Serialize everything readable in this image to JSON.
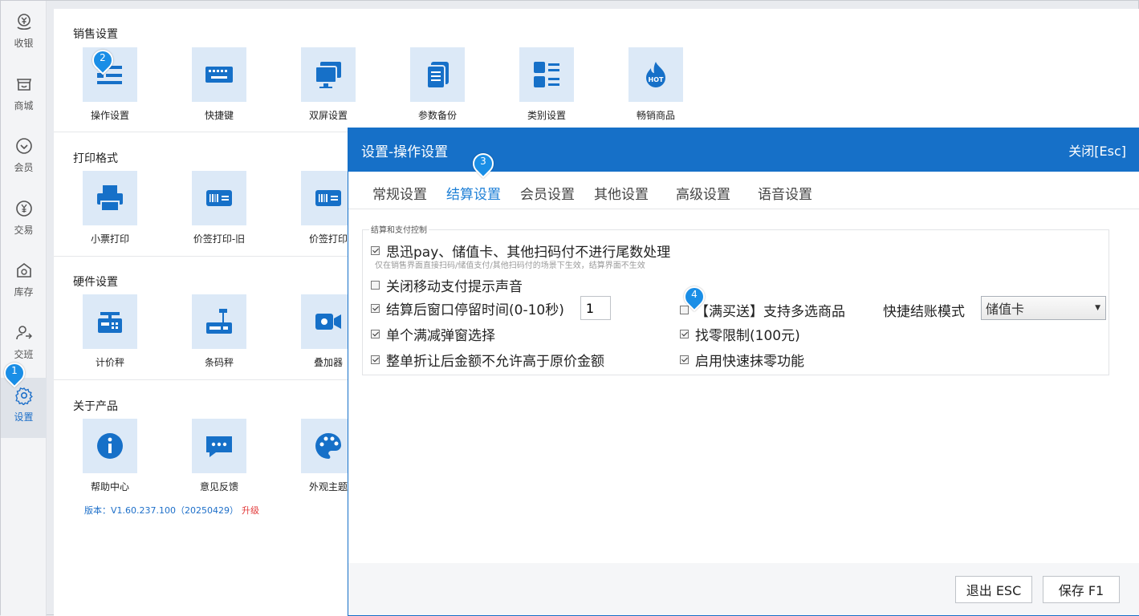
{
  "nav": {
    "items": [
      {
        "label": "收银",
        "icon": "cashier-icon"
      },
      {
        "label": "商城",
        "icon": "store-icon"
      },
      {
        "label": "会员",
        "icon": "member-icon"
      },
      {
        "label": "交易",
        "icon": "transaction-icon"
      },
      {
        "label": "库存",
        "icon": "inventory-icon"
      },
      {
        "label": "交班",
        "icon": "shift-icon"
      },
      {
        "label": "设置",
        "icon": "settings-gear-icon"
      }
    ]
  },
  "main": {
    "sections": [
      {
        "title": "销售设置",
        "tiles": [
          "操作设置",
          "快捷键",
          "双屏设置",
          "参数备份",
          "类别设置",
          "畅销商品"
        ]
      },
      {
        "title": "打印格式",
        "tiles": [
          "小票打印",
          "价签打印-旧",
          "价签打印"
        ]
      },
      {
        "title": "硬件设置",
        "tiles": [
          "计价秤",
          "条码秤",
          "叠加器"
        ]
      },
      {
        "title": "关于产品",
        "tiles": [
          "帮助中心",
          "意见反馈",
          "外观主题"
        ]
      }
    ],
    "version": "版本：V1.60.237.100（20250429）",
    "upgrade": "升级"
  },
  "markers": [
    "1",
    "2",
    "3",
    "4"
  ],
  "dialog": {
    "title": "设置-操作设置",
    "close": "关闭[Esc]",
    "tabs": [
      "常规设置",
      "结算设置",
      "会员设置",
      "其他设置",
      "高级设置",
      "语音设置"
    ],
    "active_tab": "结算设置",
    "group_title": "结算和支付控制",
    "options": {
      "rounding": "思迅pay、储值卡、其他扫码付不进行尾数处理",
      "rounding_hint": "仅在销售界面直接扫码/储值支付/其他扫码付的场景下生效，结算界面不生效",
      "mute": "关闭移动支付提示声音",
      "stay_time": "结算后窗口停留时间(0-10秒)",
      "stay_value": "1",
      "discount_popup": "单个满减弹窗选择",
      "no_exceed": "整单折让后金额不允许高于原价金额",
      "buy_gift": "【满买送】支持多选商品",
      "change_limit": "找零限制(100元)",
      "quick_round": "启用快速抹零功能"
    },
    "mode_label": "快捷结账模式",
    "mode_value": "储值卡",
    "exit_btn": "退出 ESC",
    "save_btn": "保存 F1"
  }
}
